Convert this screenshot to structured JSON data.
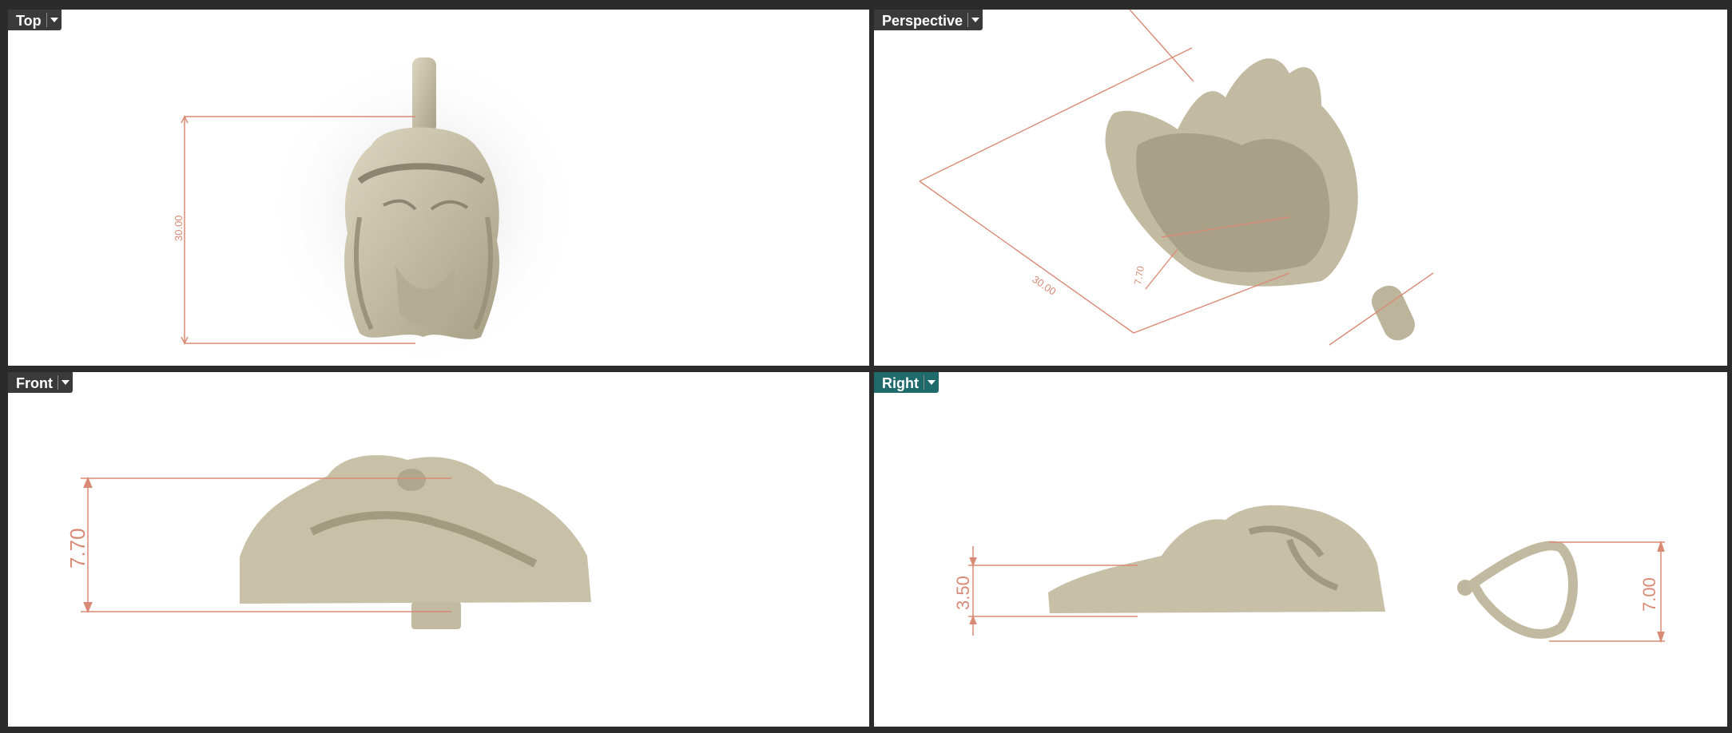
{
  "viewports": {
    "top": {
      "label": "Top",
      "dimension": "30.00"
    },
    "perspective": {
      "label": "Perspective",
      "dimension_a": "30.00",
      "dimension_b": "7.70"
    },
    "front": {
      "label": "Front",
      "dimension": "7.70"
    },
    "right": {
      "label": "Right",
      "dimension_a": "3.50",
      "dimension_b": "7.00",
      "active": true
    }
  },
  "colors": {
    "model": "#cfc7ae",
    "model_shade": "#9e967d",
    "dimension": "#d98a75",
    "active_tab": "#1f6b6b",
    "tab": "#3a3a3a",
    "frame": "#2b2b2b"
  }
}
